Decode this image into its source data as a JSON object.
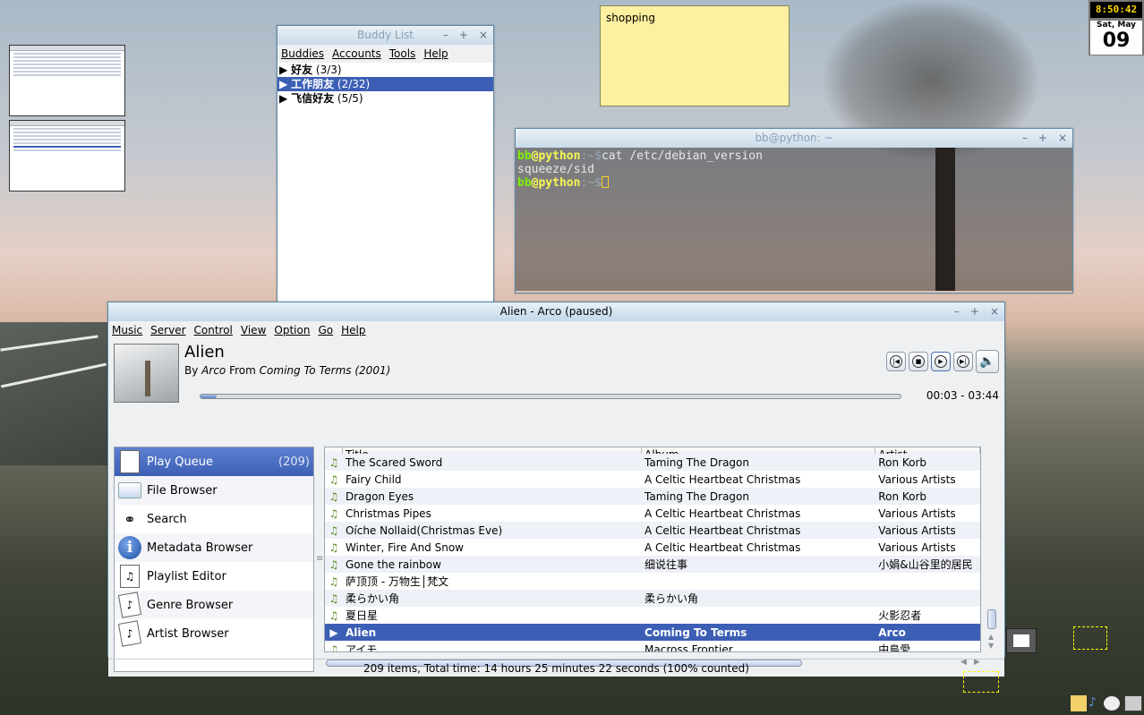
{
  "clock": {
    "time": "8:50:42",
    "weekday_month": "Sat, May",
    "day": "09"
  },
  "sticky": {
    "text": "shopping"
  },
  "buddy_list": {
    "title": "Buddy List",
    "menu": [
      "Buddies",
      "Accounts",
      "Tools",
      "Help"
    ],
    "groups": [
      {
        "arrow": "▶",
        "name": "好友",
        "count": "(3/3)"
      },
      {
        "arrow": "▶",
        "name": "工作朋友",
        "count": "(2/32)"
      },
      {
        "arrow": "▶",
        "name": "飞信好友",
        "count": "(5/5)"
      }
    ]
  },
  "terminal": {
    "title": "bb@python: ~",
    "user": "bb",
    "at": "@",
    "host": "python",
    "path": ":~$",
    "command": "cat /etc/debian_version",
    "output": "squeeze/sid"
  },
  "player": {
    "title": "Alien - Arco (paused)",
    "menu": [
      "Music",
      "Server",
      "Control",
      "View",
      "Option",
      "Go",
      "Help"
    ],
    "song_title": "Alien",
    "by_label": "By",
    "artist": "Arco",
    "from_label": "From",
    "album": "Coming To Terms (2001)",
    "progress_fraction": 0.006,
    "time": "00:03 - 03:44",
    "sidebar": [
      {
        "label": "Play Queue",
        "count": "(209)",
        "icon": "play-queue-icon"
      },
      {
        "label": "File Browser",
        "icon": "file-browser-icon"
      },
      {
        "label": "Search",
        "icon": "binoculars-icon"
      },
      {
        "label": "Metadata Browser",
        "icon": "info-icon"
      },
      {
        "label": "Playlist Editor",
        "icon": "playlist-icon"
      },
      {
        "label": "Genre Browser",
        "icon": "genre-icon"
      },
      {
        "label": "Artist Browser",
        "icon": "artist-icon"
      }
    ],
    "columns": [
      "Title",
      "Album",
      "Artist"
    ],
    "rows": [
      {
        "title": "The Scared Sword",
        "album": "Taming The Dragon",
        "artist": "Ron Korb"
      },
      {
        "title": "Fairy Child",
        "album": "A Celtic Heartbeat Christmas",
        "artist": "Various Artists"
      },
      {
        "title": "Dragon Eyes",
        "album": "Taming The Dragon",
        "artist": "Ron Korb"
      },
      {
        "title": "Christmas Pipes",
        "album": "A Celtic Heartbeat Christmas",
        "artist": "Various Artists"
      },
      {
        "title": "Oíche Nollaid(Christmas Eve)",
        "album": "A Celtic Heartbeat Christmas",
        "artist": "Various Artists"
      },
      {
        "title": "Winter, Fire And Snow",
        "album": "A Celtic Heartbeat Christmas",
        "artist": "Various Artists"
      },
      {
        "title": "Gone the rainbow",
        "album": "细说往事",
        "artist": "小娟&山谷里的居民"
      },
      {
        "title": "萨顶顶 - 万物生│梵文",
        "album": "",
        "artist": ""
      },
      {
        "title": "柔らかい角",
        "album": "柔らかい角",
        "artist": ""
      },
      {
        "title": "夏日星",
        "album": "",
        "artist": "火影忍者"
      },
      {
        "title": "Alien",
        "album": "Coming To Terms",
        "artist": "Arco",
        "current": true
      },
      {
        "title": "アイモ",
        "album": "Macross Frontier",
        "artist": "中島愛"
      }
    ],
    "status": "209 items,  Total time: 14 hours 25 minutes 22 seconds  (100% counted)"
  }
}
